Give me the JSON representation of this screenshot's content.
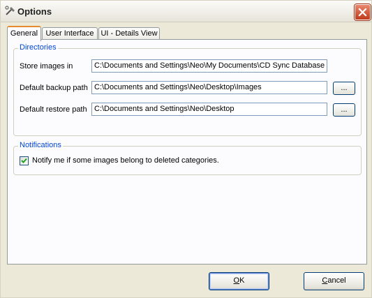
{
  "window": {
    "title": "Options",
    "close_symbol": "×"
  },
  "tabs": [
    {
      "label": "General",
      "active": true
    },
    {
      "label": "User Interface",
      "active": false
    },
    {
      "label": "UI - Details View",
      "active": false
    }
  ],
  "directories": {
    "legend": "Directories",
    "store": {
      "label": "Store images in",
      "value": "C:\\Documents and Settings\\Neo\\My Documents\\CD Sync Database"
    },
    "backup": {
      "label": "Default backup path",
      "value": "C:\\Documents and Settings\\Neo\\Desktop\\Images",
      "browse_label": "..."
    },
    "restore": {
      "label": "Default restore path",
      "value": "C:\\Documents and Settings\\Neo\\Desktop",
      "browse_label": "..."
    }
  },
  "notifications": {
    "legend": "Notifications",
    "checkbox_label": "Notify me if some images belong to deleted categories.",
    "checked": true
  },
  "buttons": {
    "ok_mnemonic": "O",
    "ok_rest": "K",
    "cancel_mnemonic": "C",
    "cancel_rest": "ancel"
  },
  "colors": {
    "accent_tab": "#e68b2c",
    "group_legend": "#0046d5",
    "check_mark": "#21a121",
    "close_red": "#c0391b"
  }
}
